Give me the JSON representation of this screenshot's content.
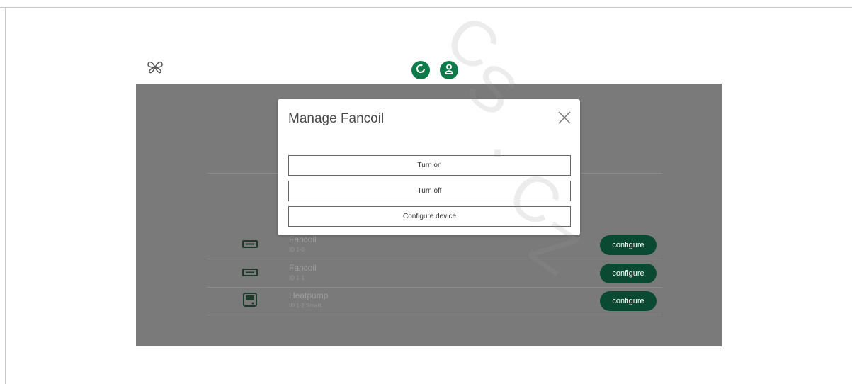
{
  "watermark": [
    "C",
    "S",
    ".",
    "C",
    "Z"
  ],
  "colors": {
    "accent": "#0e7a4a",
    "configure_bg": "#0a4a32",
    "overlay": "#7a7a7a"
  },
  "header": {
    "logo_icon": "butterfly-logo-icon",
    "buttons": [
      {
        "icon": "refresh-icon"
      },
      {
        "icon": "user-icon"
      }
    ]
  },
  "devices": [
    {
      "icon": "fancoil-icon",
      "name": "Fancoil",
      "sub": "ID 1-0",
      "configure_label": "configure"
    },
    {
      "icon": "fancoil-icon",
      "name": "Fancoil",
      "sub": "ID 1-1",
      "configure_label": "configure"
    },
    {
      "icon": "thermostat-icon",
      "name": "Heatpump",
      "sub": "ID 1-2 Smart",
      "configure_label": "configure"
    }
  ],
  "modal": {
    "title": "Manage Fancoil",
    "close_icon": "close-icon",
    "buttons": [
      "Turn on",
      "Turn off",
      "Configure device"
    ]
  }
}
